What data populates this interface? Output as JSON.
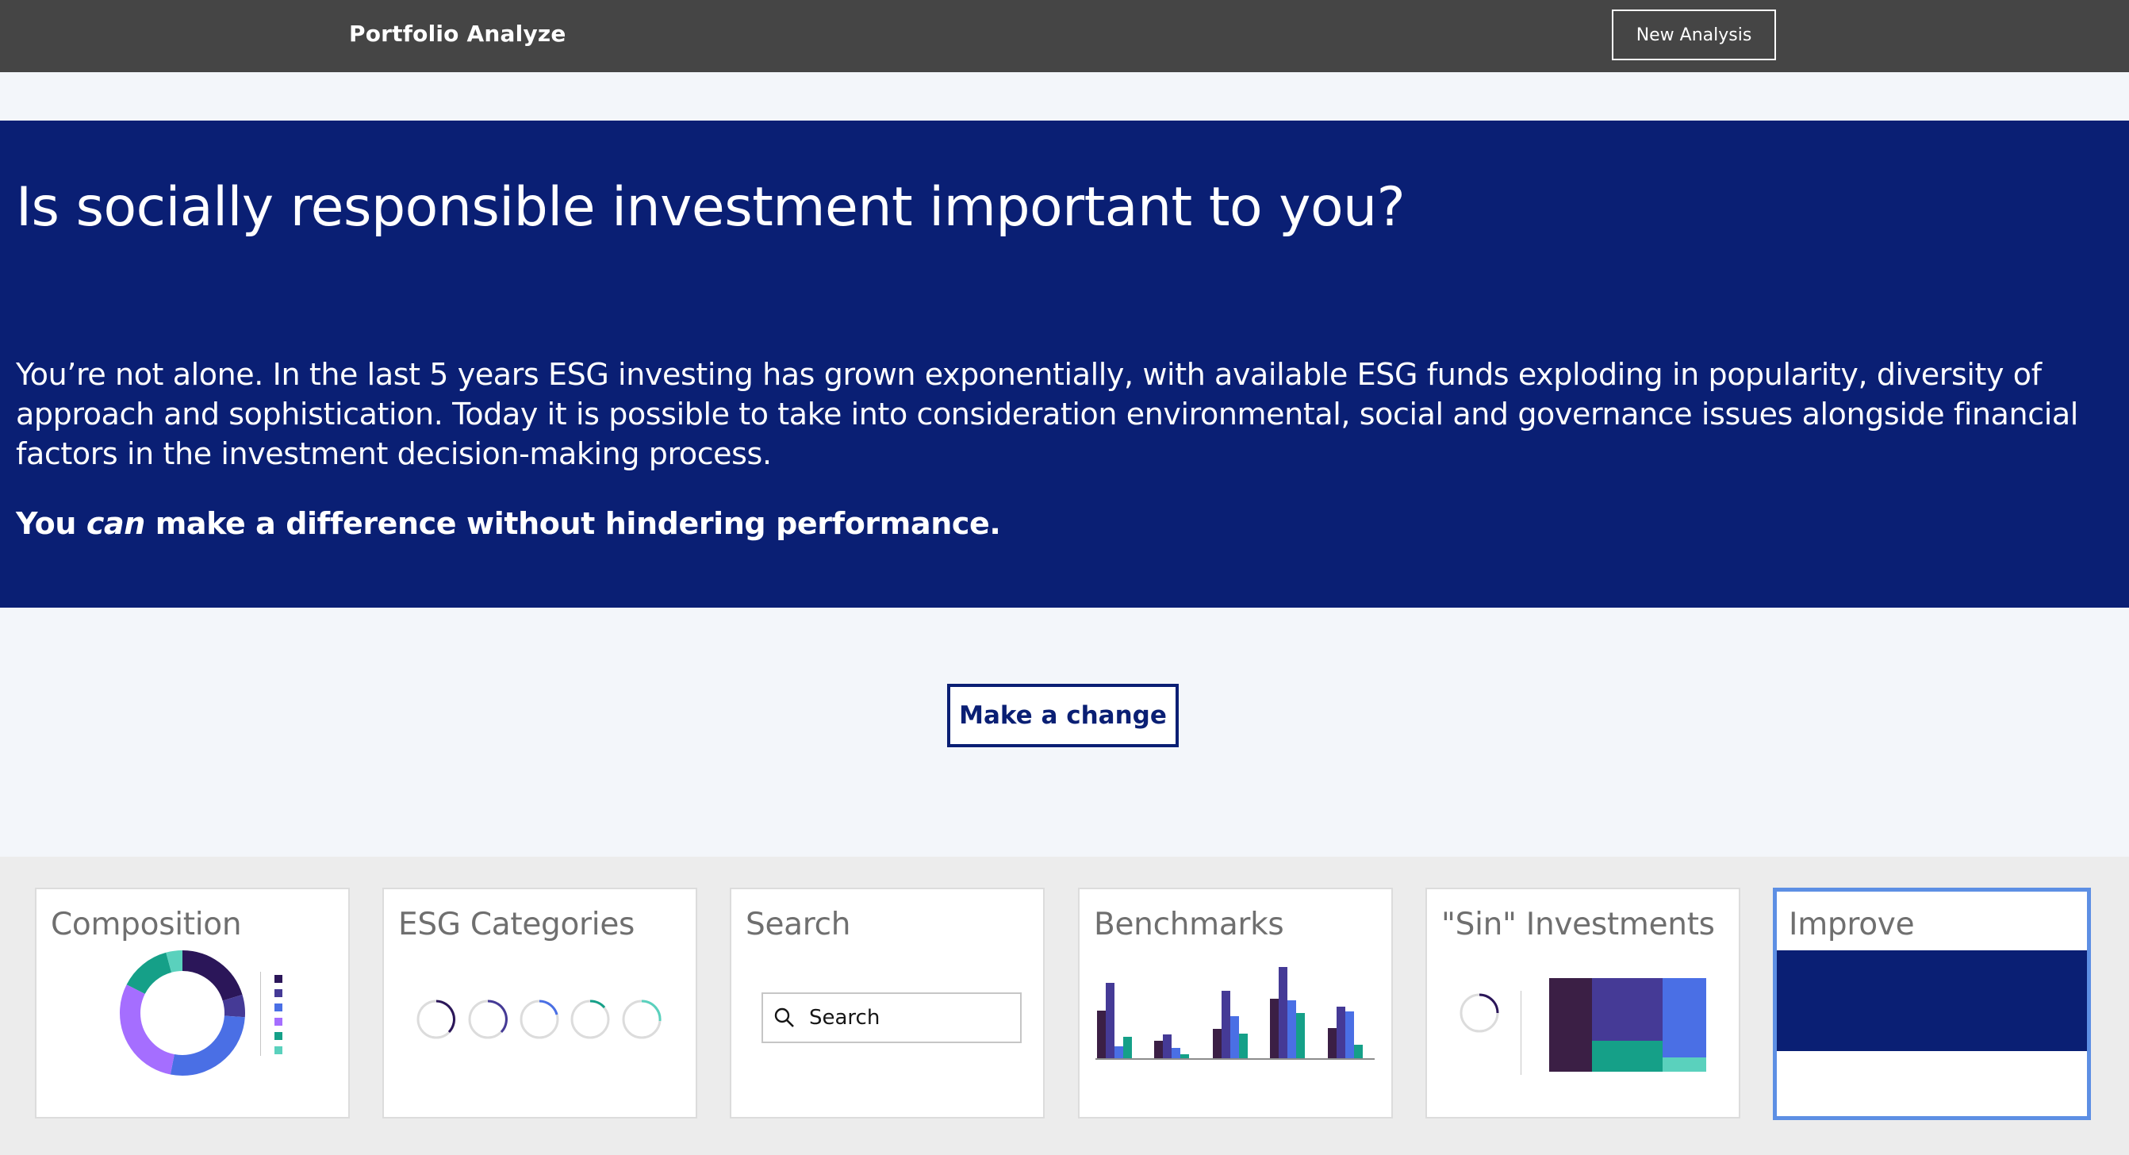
{
  "header": {
    "brand": "Portfolio Analyze",
    "new_analysis_label": "New Analysis"
  },
  "hero": {
    "title": "Is socially responsible investment important to you?",
    "body": "You’re not alone. In the last 5 years ESG investing has grown exponentially, with available ESG funds exploding in popularity, diversity of approach and sophistication. Today it is possible to take into consideration environmental, social and governance issues alongside financial factors in the investment decision-making process.",
    "bold_before": "You ",
    "bold_emphasis": "can",
    "bold_after": " make a difference without hindering performance."
  },
  "cta": {
    "label": "Make a change"
  },
  "cards": {
    "composition": {
      "title": "Composition"
    },
    "esg": {
      "title": "ESG Categories"
    },
    "search": {
      "title": "Search",
      "placeholder": "Search"
    },
    "benchmarks": {
      "title": "Benchmarks"
    },
    "sin": {
      "title": "\"Sin\" Investments"
    },
    "improve": {
      "title": "Improve"
    }
  },
  "colors": {
    "brand_navy": "#0a1f74",
    "topbar": "#454545",
    "purple_dark": "#3b1f45",
    "purple": "#453a96",
    "blue": "#4a6fe5",
    "lavender": "#a56eff",
    "teal": "#15a088",
    "aqua": "#5ad1bd",
    "active_border": "#5d8fe4"
  }
}
